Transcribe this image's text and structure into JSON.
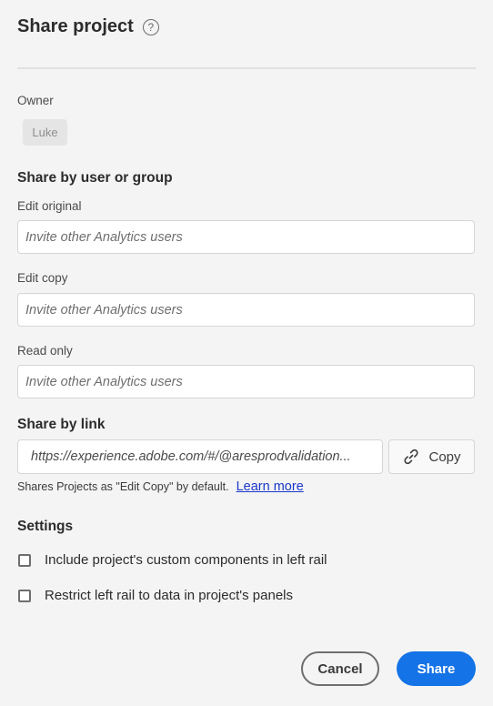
{
  "dialog": {
    "title": "Share project",
    "help_icon": "question-circle-icon",
    "help_glyph": "?"
  },
  "owner": {
    "label": "Owner",
    "name": "Luke"
  },
  "share_by_user": {
    "heading": "Share by user or group",
    "fields": [
      {
        "label": "Edit original",
        "placeholder": "Invite other Analytics users"
      },
      {
        "label": "Edit copy",
        "placeholder": "Invite other Analytics users"
      },
      {
        "label": "Read only",
        "placeholder": "Invite other Analytics users"
      }
    ]
  },
  "share_by_link": {
    "heading": "Share by link",
    "url": "https://experience.adobe.com/#/@aresprodvalidation...",
    "copy_label": "Copy",
    "copy_icon": "link-icon",
    "helper_text": "Shares Projects as \"Edit Copy\" by default.",
    "learn_more": "Learn more"
  },
  "settings": {
    "heading": "Settings",
    "options": [
      {
        "label": "Include project's custom components in left rail",
        "checked": false
      },
      {
        "label": "Restrict left rail to data in project's panels",
        "checked": false
      }
    ]
  },
  "footer": {
    "cancel_label": "Cancel",
    "share_label": "Share"
  },
  "colors": {
    "background": "#f4f4f4",
    "primary_button": "#1473e6",
    "link": "#1a38c9"
  }
}
